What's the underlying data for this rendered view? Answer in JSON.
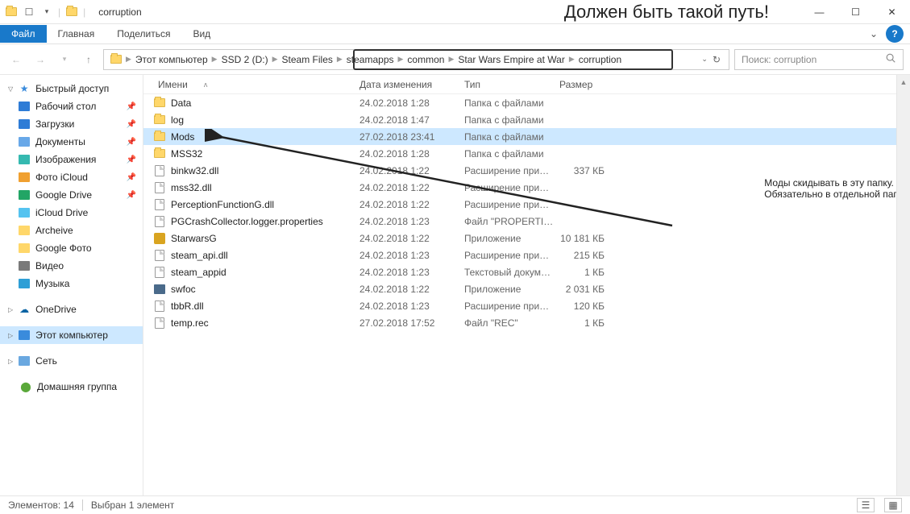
{
  "window": {
    "title": "corruption",
    "menu_file": "Файл",
    "menu_home": "Главная",
    "menu_share": "Поделиться",
    "menu_view": "Вид"
  },
  "annotation": {
    "top": "Должен быть такой путь!",
    "side_l1": "Моды скидывать в эту папку.",
    "side_l2": "Обязательно в отдельной папке"
  },
  "breadcrumb": [
    "Этот компьютер",
    "SSD 2 (D:)",
    "Steam Files",
    "steamapps",
    "common",
    "Star Wars Empire at War",
    "corruption"
  ],
  "search_placeholder": "Поиск: corruption",
  "columns": {
    "name": "Имени",
    "date": "Дата изменения",
    "type": "Тип",
    "size": "Размер"
  },
  "sidebar": {
    "quick_access": "Быстрый доступ",
    "items_quick": [
      {
        "label": "Рабочий стол",
        "pin": true,
        "color": "#2e7cd6"
      },
      {
        "label": "Загрузки",
        "pin": true,
        "color": "#2e7cd6"
      },
      {
        "label": "Документы",
        "pin": true,
        "color": "#68a8e8"
      },
      {
        "label": "Изображения",
        "pin": true,
        "color": "#35b9b0"
      },
      {
        "label": "Фото iCloud",
        "pin": true,
        "color": "#f0a030"
      },
      {
        "label": "Google Drive",
        "pin": true,
        "color": "#22a565"
      },
      {
        "label": "iCloud Drive",
        "pin": false,
        "color": "#55c3f0"
      },
      {
        "label": "Archeive",
        "pin": false,
        "color": "#ffd76a"
      },
      {
        "label": "Google Фото",
        "pin": false,
        "color": "#ffd76a"
      },
      {
        "label": "Видео",
        "pin": false,
        "color": "#7a7a7a"
      },
      {
        "label": "Музыка",
        "pin": false,
        "color": "#2e9fd6"
      }
    ],
    "onedrive": "OneDrive",
    "this_pc": "Этот компьютер",
    "network": "Сеть",
    "homegroup": "Домашняя группа"
  },
  "files": [
    {
      "name": "Data",
      "date": "24.02.2018 1:28",
      "type": "Папка с файлами",
      "size": "",
      "kind": "folder"
    },
    {
      "name": "log",
      "date": "24.02.2018 1:47",
      "type": "Папка с файлами",
      "size": "",
      "kind": "folder"
    },
    {
      "name": "Mods",
      "date": "27.02.2018 23:41",
      "type": "Папка с файлами",
      "size": "",
      "kind": "folder",
      "selected": true
    },
    {
      "name": "MSS32",
      "date": "24.02.2018 1:28",
      "type": "Папка с файлами",
      "size": "",
      "kind": "folder"
    },
    {
      "name": "binkw32.dll",
      "date": "24.02.2018 1:22",
      "type": "Расширение при…",
      "size": "337 КБ",
      "kind": "file"
    },
    {
      "name": "mss32.dll",
      "date": "24.02.2018 1:22",
      "type": "Расширение при…",
      "size": "",
      "kind": "file"
    },
    {
      "name": "PerceptionFunctionG.dll",
      "date": "24.02.2018 1:22",
      "type": "Расширение при…",
      "size": "",
      "kind": "file"
    },
    {
      "name": "PGCrashCollector.logger.properties",
      "date": "24.02.2018 1:23",
      "type": "Файл \"PROPERTIES\"",
      "size": "",
      "kind": "file"
    },
    {
      "name": "StarwarsG",
      "date": "24.02.2018 1:22",
      "type": "Приложение",
      "size": "10 181 КБ",
      "kind": "exe"
    },
    {
      "name": "steam_api.dll",
      "date": "24.02.2018 1:23",
      "type": "Расширение при…",
      "size": "215 КБ",
      "kind": "file"
    },
    {
      "name": "steam_appid",
      "date": "24.02.2018 1:23",
      "type": "Текстовый докум…",
      "size": "1 КБ",
      "kind": "file"
    },
    {
      "name": "swfoc",
      "date": "24.02.2018 1:22",
      "type": "Приложение",
      "size": "2 031 КБ",
      "kind": "exe2"
    },
    {
      "name": "tbbR.dll",
      "date": "24.02.2018 1:23",
      "type": "Расширение при…",
      "size": "120 КБ",
      "kind": "file"
    },
    {
      "name": "temp.rec",
      "date": "27.02.2018 17:52",
      "type": "Файл \"REC\"",
      "size": "1 КБ",
      "kind": "file"
    }
  ],
  "status": {
    "count": "Элементов: 14",
    "selected": "Выбран 1 элемент"
  }
}
